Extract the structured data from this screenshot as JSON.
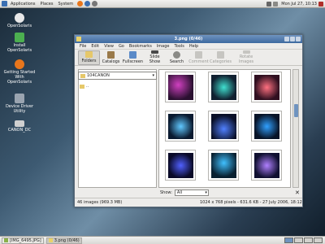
{
  "top_panel": {
    "menus": [
      "Applications",
      "Places",
      "System"
    ],
    "clock": "Mon Jul 27, 10:13"
  },
  "desktop_icons": [
    {
      "label": "OpenSolaris",
      "icon": "opensolaris-disc-icon",
      "color": "#e8e8e8"
    },
    {
      "label": "Install OpenSolaris",
      "icon": "install-icon",
      "color": "#4caf50"
    },
    {
      "label": "Getting Started With OpenSolaris",
      "icon": "firefox-icon",
      "color": "#e8761c"
    },
    {
      "label": "Device Driver Utility",
      "icon": "device-driver-icon",
      "color": "#9aa4b0"
    },
    {
      "label": "CANON_DC",
      "icon": "drive-icon",
      "color": "#d0d0d0"
    }
  ],
  "window": {
    "title": "3.png  (0/46)",
    "menubar": [
      "File",
      "Edit",
      "View",
      "Go",
      "Bookmarks",
      "Image",
      "Tools",
      "Help"
    ],
    "toolbar": [
      {
        "label": "Folders",
        "icon": "folder-icon",
        "active": true,
        "disabled": false
      },
      {
        "label": "Catalogs",
        "icon": "catalog-icon",
        "active": false,
        "disabled": false
      },
      {
        "label": "Fullscreen",
        "icon": "fullscreen-icon",
        "active": false,
        "disabled": false
      },
      {
        "label": "Slide Show",
        "icon": "slideshow-icon",
        "active": false,
        "disabled": false
      },
      {
        "label": "Search",
        "icon": "search-icon",
        "active": false,
        "disabled": false
      },
      {
        "label": "Comment",
        "icon": "comment-icon",
        "active": false,
        "disabled": true
      },
      {
        "label": "Categories",
        "icon": "categories-icon",
        "active": false,
        "disabled": true
      },
      {
        "label": "Rotate Images",
        "icon": "rotate-icon",
        "active": false,
        "disabled": true
      }
    ],
    "folder_combo": "104CANON",
    "folder_item": "..",
    "show_label": "Show:",
    "show_value": "All",
    "status_left": "46 images (969.3 MB)",
    "status_right": "1024 x 768 pixels - 631.6 KB - 27 July 2006, 18:12"
  },
  "thumbnails": [
    {
      "bg": "radial-gradient(circle at 40% 40%, #d040c0, #2a1030 70%)"
    },
    {
      "bg": "radial-gradient(circle at 50% 50%, #40e0d0, #102030 70%)"
    },
    {
      "bg": "radial-gradient(circle at 50% 50%, #ff7080, #301020 70%)"
    },
    {
      "bg": "radial-gradient(circle at 50% 50%, #60c8ff, #0a1a30 70%)"
    },
    {
      "bg": "radial-gradient(circle at 50% 60%, #5080ff, #0a1028 70%)"
    },
    {
      "bg": "radial-gradient(circle at 50% 50%, #30a0ff, #081428 70%)"
    },
    {
      "bg": "radial-gradient(circle at 50% 50%, #5060ff, #0a0a28 70%)"
    },
    {
      "bg": "radial-gradient(circle at 50% 40%, #40c0ff, #082030 70%)"
    },
    {
      "bg": "radial-gradient(circle at 50% 50%, #b080ff, #101030 70%)"
    }
  ],
  "taskbar": {
    "items": [
      {
        "label": "[IMG_6495.JPG]",
        "active": false
      },
      {
        "label": "3.png  (0/46)",
        "active": true
      }
    ]
  }
}
